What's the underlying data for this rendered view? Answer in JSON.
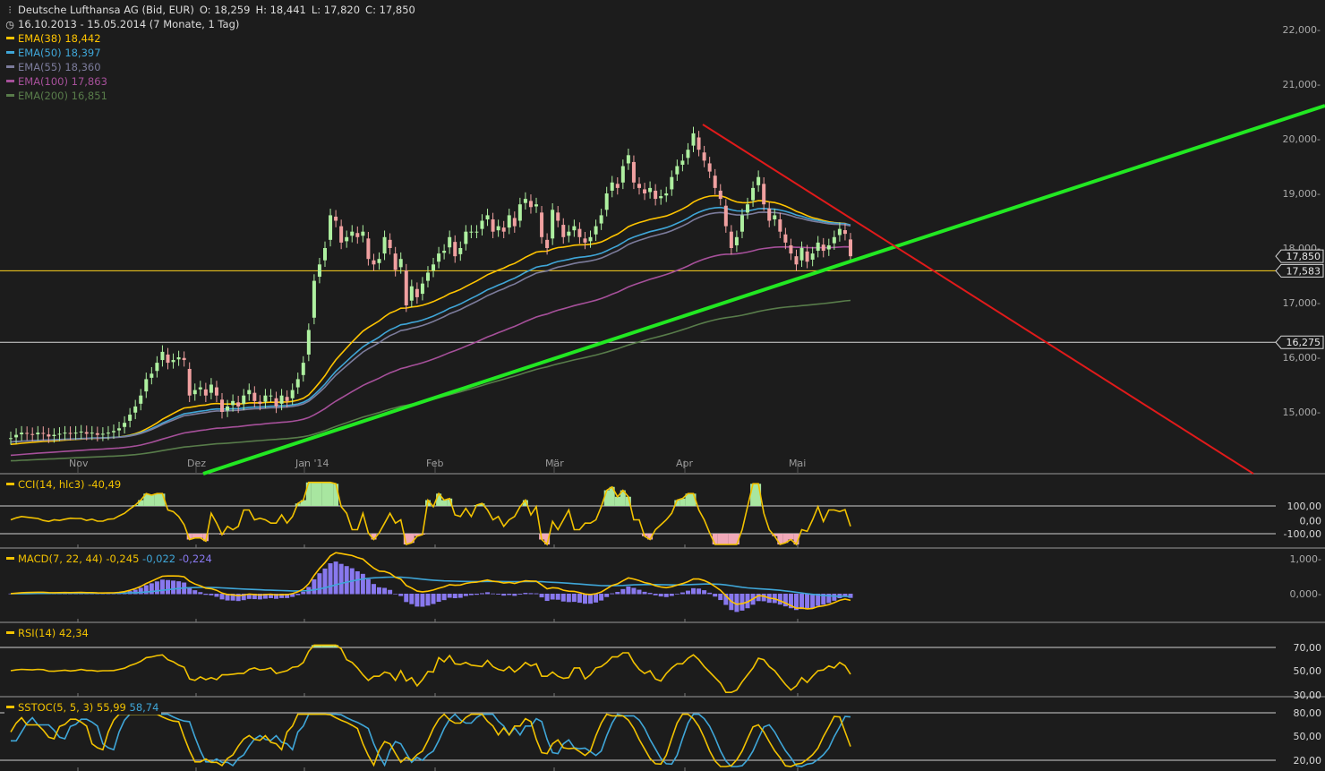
{
  "instrument": {
    "name": "Deutsche Lufthansa AG (Bid, EUR)",
    "open": "O: 18,259",
    "high": "H: 18,441",
    "low": "L: 17,820",
    "close": "C: 17,850",
    "range": "16.10.2013 - 15.05.2014 (7 Monate, 1 Tag)",
    "chart_icon": "candlestick-icon",
    "clock_icon": "clock-icon"
  },
  "colors": {
    "background": "#1c1c1c",
    "candle_up": "#aef0a0",
    "candle_down": "#f0a0a0",
    "ema38": "#ffc400",
    "ema50": "#3fa6d8",
    "ema55": "#7c7c9c",
    "ema100": "#a6509a",
    "ema200": "#587c4a",
    "trend_up": "#22e822",
    "trend_down": "#e01a1a",
    "cci": "#f2c200",
    "macd_hist": "#8878ee",
    "macd_signal": "#3fa6d8",
    "stoch_d": "#3fa6d8"
  },
  "legend": [
    {
      "label": "EMA(38)",
      "value": "18,442",
      "color": "#ffc400"
    },
    {
      "label": "EMA(50)",
      "value": "18,397",
      "color": "#3fa6d8"
    },
    {
      "label": "EMA(55)",
      "value": "18,360",
      "color": "#7c7c9c"
    },
    {
      "label": "EMA(100)",
      "value": "17,863",
      "color": "#a6509a"
    },
    {
      "label": "EMA(200)",
      "value": "16,851",
      "color": "#587c4a"
    }
  ],
  "price_axis": {
    "ticks": [
      "22,000",
      "21,000",
      "20,000",
      "19,000",
      "18,000",
      "17,000",
      "16,000",
      "15,000"
    ],
    "tags": [
      "17,850",
      "17,583",
      "16,275"
    ]
  },
  "months": [
    "Nov",
    "Dez",
    "Jan '14",
    "Feb",
    "Mär",
    "Apr",
    "Mai"
  ],
  "panels": {
    "cci": {
      "label": "CCI(14, hlc3)",
      "value": "-40,49",
      "ticks": [
        "100,00",
        "0,00",
        "-100,00"
      ]
    },
    "macd": {
      "label": "MACD(7, 22, 44)",
      "v1": "-0,245",
      "v2": "-0,022",
      "v3": "-0,224",
      "ticks": [
        "1,000",
        "0,000"
      ]
    },
    "rsi": {
      "label": "RSI(14)",
      "value": "42,34",
      "ticks": [
        "70,00",
        "50,00",
        "30,00"
      ]
    },
    "sstoc": {
      "label": "SSTOC(5, 5, 3)",
      "v1": "55,99",
      "v2": "58,74",
      "ticks": [
        "80,00",
        "50,00",
        "20,00"
      ]
    }
  },
  "chart_data": {
    "type": "candlestick",
    "title": "Deutsche Lufthansa AG (Bid, EUR)",
    "period": "16.10.2013 - 15.05.2014",
    "ylim": [
      14.45,
      22.5
    ],
    "last_ohlc": {
      "open": 18.259,
      "high": 18.441,
      "low": 17.82,
      "close": 17.85
    },
    "horizontal_lines": [
      17.583,
      16.275
    ],
    "ema_last": {
      "EMA(38)": 18.442,
      "EMA(50)": 18.397,
      "EMA(55)": 18.36,
      "EMA(100)": 17.863,
      "EMA(200)": 16.851
    },
    "trendlines": [
      {
        "name": "support",
        "color": "green",
        "from": [
          "2013-12-01",
          14.5
        ],
        "to": [
          "2014-05-14",
          17.8
        ]
      },
      {
        "name": "resistance",
        "color": "red",
        "from": [
          "2014-04-04",
          20.25
        ],
        "to": [
          "2014-05-13",
          18.45
        ]
      }
    ],
    "closes_approx": [
      14.52,
      14.58,
      14.62,
      14.6,
      14.58,
      14.62,
      14.6,
      14.55,
      14.58,
      14.6,
      14.62,
      14.6,
      14.62,
      14.64,
      14.6,
      14.62,
      14.58,
      14.6,
      14.62,
      14.65,
      14.7,
      14.8,
      14.95,
      15.1,
      15.3,
      15.6,
      15.7,
      15.9,
      16.1,
      15.9,
      15.95,
      16.0,
      15.95,
      15.3,
      15.4,
      15.45,
      15.3,
      15.5,
      15.3,
      15.0,
      15.1,
      15.2,
      15.1,
      15.3,
      15.4,
      15.2,
      15.15,
      15.3,
      15.3,
      15.1,
      15.3,
      15.2,
      15.4,
      15.6,
      15.9,
      16.5,
      17.4,
      17.7,
      18.0,
      18.6,
      18.5,
      18.1,
      18.2,
      18.3,
      18.2,
      18.3,
      17.8,
      17.7,
      17.8,
      18.2,
      18.0,
      17.6,
      17.8,
      16.95,
      17.3,
      17.1,
      17.35,
      17.55,
      17.7,
      17.9,
      17.95,
      18.2,
      17.85,
      18.0,
      18.3,
      18.3,
      18.3,
      18.5,
      18.6,
      18.3,
      18.4,
      18.3,
      18.6,
      18.4,
      18.8,
      18.9,
      18.75,
      18.8,
      18.2,
      18.0,
      18.7,
      18.5,
      18.2,
      18.3,
      18.4,
      18.2,
      18.1,
      18.2,
      18.4,
      18.6,
      19.0,
      19.2,
      19.1,
      19.5,
      19.7,
      19.2,
      19.1,
      19.0,
      19.1,
      18.9,
      18.95,
      19.0,
      19.3,
      19.5,
      19.6,
      19.8,
      20.1,
      19.8,
      19.6,
      19.4,
      19.1,
      18.9,
      18.4,
      18.0,
      18.2,
      18.6,
      18.8,
      19.1,
      19.3,
      18.8,
      18.5,
      18.6,
      18.3,
      18.1,
      17.9,
      17.7,
      18.0,
      17.75,
      17.9,
      18.1,
      17.95,
      18.05,
      18.2,
      18.35,
      18.26,
      17.85
    ]
  }
}
